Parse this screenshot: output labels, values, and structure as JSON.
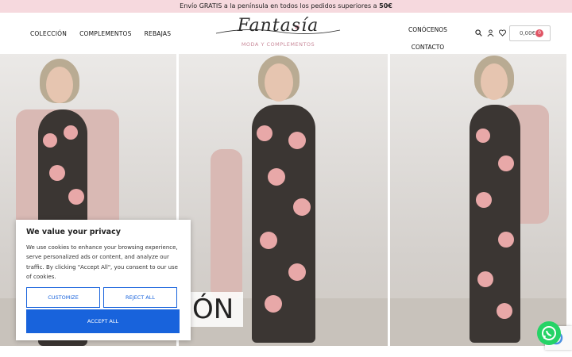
{
  "announcement": {
    "text": "Envío GRATIS a la península en todos los pedidos superiores a ",
    "amount": "50€"
  },
  "nav": {
    "left": [
      "COLECCIÓN",
      "COMPLEMENTOS",
      "REBAJAS"
    ],
    "right": [
      "CONÓCENOS",
      "CONTACTO"
    ]
  },
  "logo": {
    "brand": "Fantasía",
    "tagline": "MODA Y COMPLEMENTOS"
  },
  "cart": {
    "total": "0,00€",
    "count": "0"
  },
  "icons": [
    "search-icon",
    "user-icon",
    "heart-icon"
  ],
  "banner": {
    "overlay_text": "ÓN"
  },
  "cookie": {
    "title": "We value your privacy",
    "body": "We use cookies to enhance your browsing experience, serve personalized ads or content, and analyze our traffic. By clicking \"Accept All\", you consent to our use of cookies.",
    "customize": "CUSTOMIZE",
    "reject": "REJECT ALL",
    "accept": "ACCEPT ALL"
  },
  "colors": {
    "accent": "#1863dc",
    "topbar": "#f6d9de",
    "badge": "#e05565",
    "whatsapp": "#25d366"
  }
}
